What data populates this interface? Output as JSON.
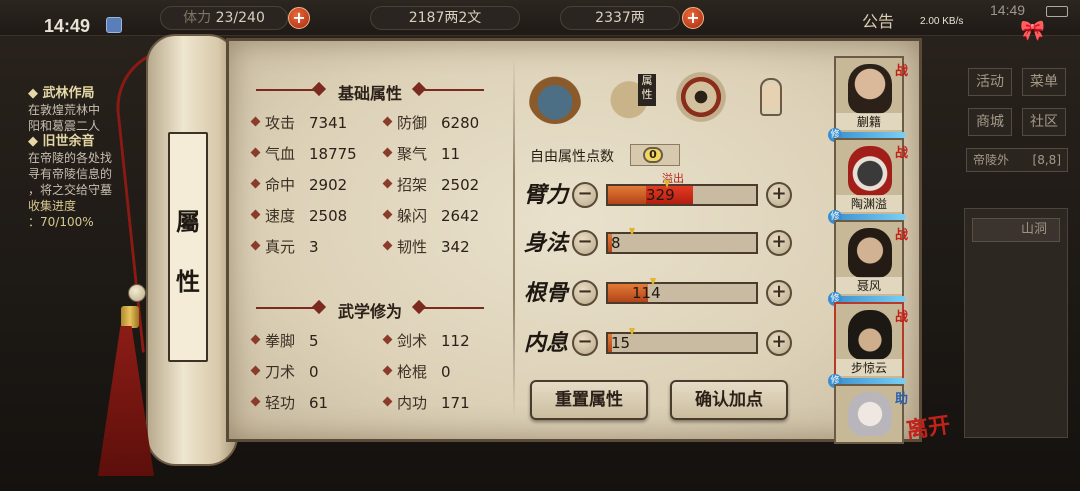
{
  "status_bar": {
    "time": "14:49",
    "net_speed": "2.00 KB/s",
    "network": "5G",
    "time_right": "14:49"
  },
  "top_resources": [
    {
      "value": "23/240",
      "prefix": "体力"
    },
    {
      "value": "2187两2文"
    },
    {
      "value": "2337两"
    }
  ],
  "announcement": "公告",
  "quests": [
    {
      "title": "武林作局",
      "desc": [
        "在敦煌荒林中",
        "阳和葛震二人"
      ]
    },
    {
      "title": "旧世余音",
      "desc": [
        "在帝陵的各处找",
        "寻有帝陵信息的",
        "，将之交给守墓"
      ]
    }
  ],
  "quest_progress": {
    "label": "收集进度",
    "value": "：70/100%"
  },
  "scroll_tab": {
    "line1": "屬",
    "line2": "性"
  },
  "basic_attrs": {
    "title": "基础属性",
    "rows": [
      [
        {
          "label": "攻击",
          "value": "7341"
        },
        {
          "label": "防御",
          "value": "6280"
        }
      ],
      [
        {
          "label": "气血",
          "value": "18775"
        },
        {
          "label": "聚气",
          "value": "11"
        }
      ],
      [
        {
          "label": "命中",
          "value": "2902"
        },
        {
          "label": "招架",
          "value": "2502"
        }
      ],
      [
        {
          "label": "速度",
          "value": "2508"
        },
        {
          "label": "躲闪",
          "value": "2642"
        }
      ],
      [
        {
          "label": "真元",
          "value": "3"
        },
        {
          "label": "韧性",
          "value": "342"
        }
      ]
    ]
  },
  "martial_attrs": {
    "title": "武学修为",
    "rows": [
      [
        {
          "label": "拳脚",
          "value": "5"
        },
        {
          "label": "剑术",
          "value": "112"
        }
      ],
      [
        {
          "label": "刀术",
          "value": "0"
        },
        {
          "label": "枪棍",
          "value": "0"
        }
      ],
      [
        {
          "label": "轻功",
          "value": "61"
        },
        {
          "label": "内功",
          "value": "171"
        }
      ]
    ]
  },
  "category_icons": {
    "hat": "bamboo-hat-icon",
    "book": "attribute-book-icon",
    "book_flag": "属性",
    "bagua": "bagua-icon",
    "body": "meridian-body-icon"
  },
  "free_points": {
    "label": "自由属性点数",
    "value": "0"
  },
  "allocation": [
    {
      "name": "臂力",
      "value": "329",
      "fill": 0.43,
      "overflow": 0.32,
      "overflow_label": "溢出"
    },
    {
      "name": "身法",
      "value": "8",
      "fill": 0.03
    },
    {
      "name": "根骨",
      "value": "114",
      "fill": 0.27
    },
    {
      "name": "内息",
      "value": "15",
      "fill": 0.03
    }
  ],
  "buttons": {
    "reset": "重置属性",
    "confirm": "确认加点",
    "minus": "−",
    "plus": "+"
  },
  "party": [
    {
      "name": "蒯籍",
      "tag": "战"
    },
    {
      "name": "陶渊溢",
      "tag": "战"
    },
    {
      "name": "聂风",
      "tag": "战"
    },
    {
      "name": "步惊云",
      "tag": "战"
    },
    {
      "name": "",
      "tag": "助"
    }
  ],
  "leave_label": "离开",
  "right_menu": {
    "btns": [
      "活动",
      "菜单",
      "商城",
      "社区"
    ],
    "location": "帝陵外",
    "coords": "[8,8]",
    "map_item": "山洞"
  },
  "colors": {
    "accent": "#7a2a1e",
    "bar_fill": "#d2622b",
    "overflow": "#c8261a",
    "paper": "#e3d9c2"
  }
}
